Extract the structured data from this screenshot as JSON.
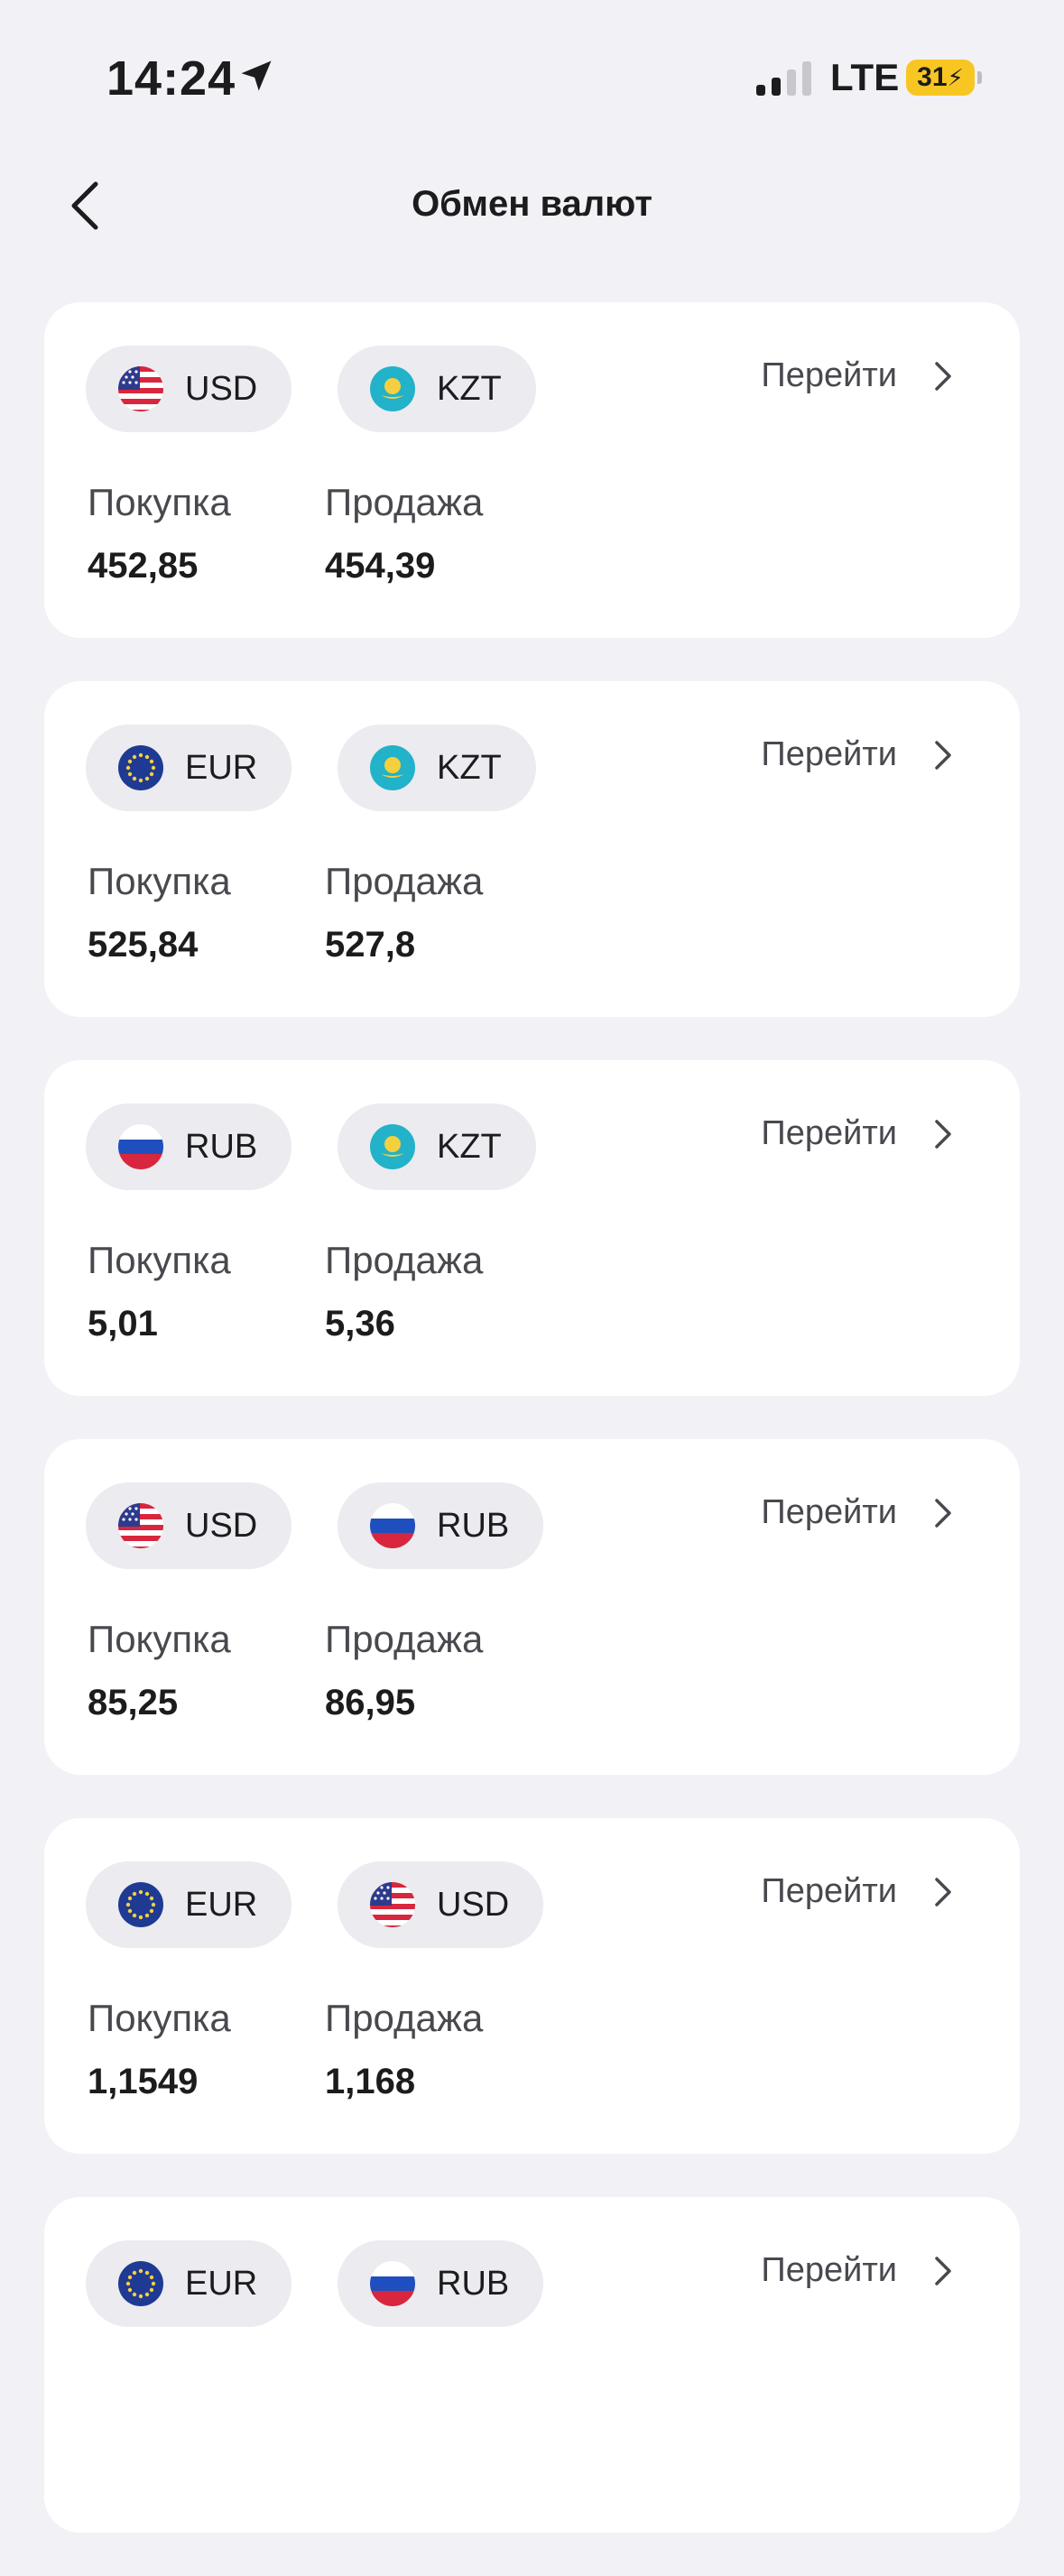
{
  "status_bar": {
    "time": "14:24",
    "network": "LTE",
    "battery": "31"
  },
  "header": {
    "title": "Обмен валют"
  },
  "labels": {
    "buy": "Покупка",
    "sell": "Продажа",
    "goto": "Перейти"
  },
  "icons": {
    "back": "chevron-left-icon",
    "goto": "chevron-right-icon",
    "location": "location-arrow-icon"
  },
  "colors": {
    "background": "#f2f2f6",
    "card": "#ffffff",
    "pill": "#ebebf0",
    "battery": "#f8c623"
  },
  "rates": [
    {
      "from": "USD",
      "to": "KZT",
      "buy": "452,85",
      "sell": "454,39"
    },
    {
      "from": "EUR",
      "to": "KZT",
      "buy": "525,84",
      "sell": "527,8"
    },
    {
      "from": "RUB",
      "to": "KZT",
      "buy": "5,01",
      "sell": "5,36"
    },
    {
      "from": "USD",
      "to": "RUB",
      "buy": "85,25",
      "sell": "86,95"
    },
    {
      "from": "EUR",
      "to": "USD",
      "buy": "1,1549",
      "sell": "1,168"
    },
    {
      "from": "EUR",
      "to": "RUB"
    }
  ]
}
